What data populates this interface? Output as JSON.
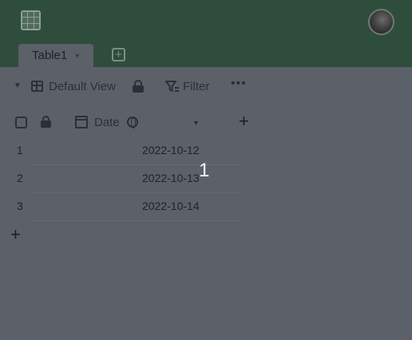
{
  "header": {
    "app_icon": "grid-app-icon",
    "avatar_icon": "user-avatar"
  },
  "tabs": [
    {
      "label": "Table1"
    }
  ],
  "toolbar": {
    "view_label": "Default View",
    "filter_label": "Filter",
    "more_icon": "more-horizontal-icon"
  },
  "table": {
    "columns": [
      {
        "label": "Date",
        "icon": "calendar-icon"
      }
    ],
    "rows": [
      {
        "number": "1",
        "date": "2022-10-12"
      },
      {
        "number": "2",
        "date": "2022-10-13"
      },
      {
        "number": "3",
        "date": "2022-10-14"
      }
    ]
  },
  "overlay": {
    "label": "1"
  },
  "colors": {
    "header_bg": "#2f4d3c",
    "content_overlay": "#5c6068",
    "text": "#1f2226"
  }
}
